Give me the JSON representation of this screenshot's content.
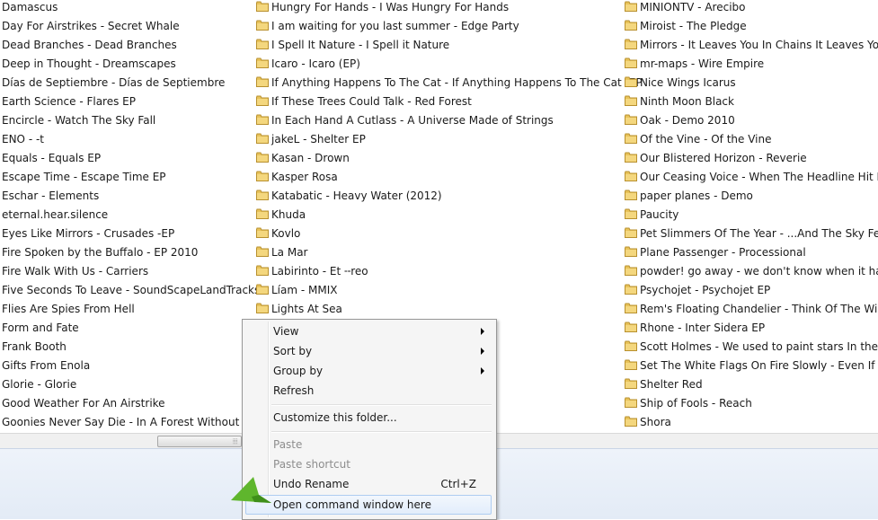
{
  "folders": {
    "col1": [
      "Damascus",
      "Day For Airstrikes - Secret Whale",
      "Dead Branches - Dead Branches",
      "Deep in Thought - Dreamscapes",
      "Días de Septiembre - Días de Septiembre",
      "Earth Science - Flares EP",
      "Encircle - Watch The Sky Fall",
      "ENO - -t",
      "Equals - Equals EP",
      "Escape Time - Escape Time EP",
      "Eschar - Elements",
      "eternal.hear.silence",
      "Eyes Like Mirrors - Crusades -EP",
      "Fire Spoken by the Buffalo - EP 2010",
      "Fire Walk With Us - Carriers",
      "Five Seconds To Leave - SoundScapeLandTracks",
      "Flies Are Spies From Hell",
      "Form and Fate",
      "Frank Booth",
      "Gifts From Enola",
      "Glorie - Glorie",
      "Good Weather For An Airstrike",
      "Goonies Never Say Die - In A Forest Without Trees"
    ],
    "col2": [
      "Hungry For Hands - I Was Hungry For Hands",
      "I am waiting for you last summer - Edge Party",
      "I Spell It Nature - I Spell it Nature",
      "Icaro - Icaro (EP)",
      "If Anything Happens To The Cat - If Anything Happens To The Cat -EP",
      "If These Trees Could Talk - Red Forest",
      "In Each Hand A Cutlass - A Universe Made of Strings",
      "jakeL - Shelter EP",
      "Kasan - Drown",
      "Kasper Rosa",
      "Katabatic - Heavy  Water (2012)",
      "Khuda",
      "Kovlo",
      "La Mar",
      "Labirinto - Et ╌reo",
      "Líam - MMIX",
      "Lights At Sea"
    ],
    "col3": [
      "MINIONTV - Arecibo",
      "Miroist - The Pledge",
      "Mirrors - It Leaves You In Chains It Leaves You In Li",
      "mr-maps - Wire Empire",
      "Nice Wings Icarus",
      "Ninth Moon Black",
      "Oak - Demo 2010",
      "Of the Vine - Of the Vine",
      "Our Blistered Horizon - Reverie",
      "Our Ceasing Voice - When The Headline Hit Home",
      "paper planes - Demo",
      "Paucity",
      "Pet Slimmers Of The Year - ...And The Sky Fell EP",
      "Plane Passenger - Processional",
      "powder! go away - we don't know when it has begu",
      "Psychojet - Psychojet EP",
      "Rem's Floating Chandelier - Think Of The Willows",
      "Rhone - Inter Sidera EP",
      "Scott Holmes - We used to paint stars In the sky",
      "Set The White Flags On Fire Slowly - Even If The Pr",
      "Shelter Red",
      "Ship of Fools - Reach",
      "Shora"
    ]
  },
  "scrollbar": {
    "grip": "⦙⦙⦙"
  },
  "menu": {
    "view": "View",
    "sort_by": "Sort by",
    "group_by": "Group by",
    "refresh": "Refresh",
    "customize": "Customize this folder...",
    "paste": "Paste",
    "paste_shortcut": "Paste shortcut",
    "undo_rename": "Undo Rename",
    "undo_rename_shortcut": "Ctrl+Z",
    "open_command_window": "Open command window here"
  },
  "colors": {
    "folder": "#e8c35a",
    "arrow": "#5fb62d"
  },
  "icons": {
    "folder": "folder-icon",
    "submenu": "submenu-arrow-icon",
    "pointer": "green-pointer-arrow-icon"
  }
}
